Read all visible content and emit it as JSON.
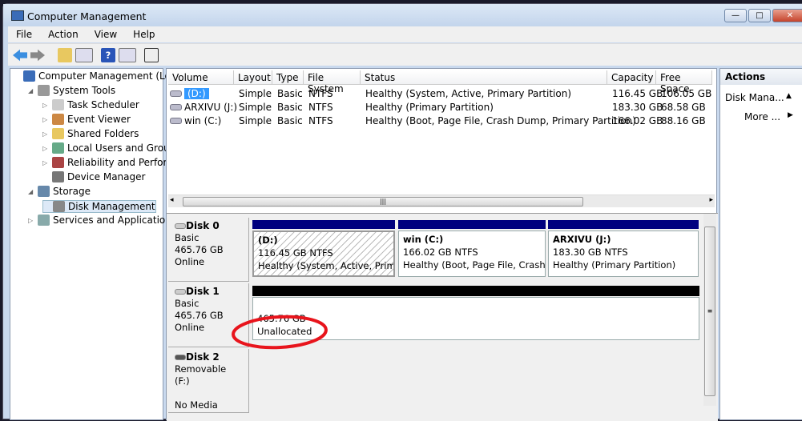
{
  "window": {
    "title": "Computer Management",
    "min": "—",
    "max": "□",
    "close": "✕"
  },
  "menu": [
    "File",
    "Action",
    "View",
    "Help"
  ],
  "toolbar": {
    "icons": [
      "back-arrow-icon",
      "forward-arrow-icon",
      "up-folder-icon",
      "show-hide-tree-icon",
      "help-icon",
      "show-action-pane-icon",
      "properties-icon"
    ]
  },
  "tree": [
    {
      "label": "Computer Management (Local",
      "level": 0,
      "exp": ""
    },
    {
      "label": "System Tools",
      "level": 1,
      "exp": "◢"
    },
    {
      "label": "Task Scheduler",
      "level": 2,
      "exp": "▷"
    },
    {
      "label": "Event Viewer",
      "level": 2,
      "exp": "▷"
    },
    {
      "label": "Shared Folders",
      "level": 2,
      "exp": "▷"
    },
    {
      "label": "Local Users and Groups",
      "level": 2,
      "exp": "▷"
    },
    {
      "label": "Reliability and Performa",
      "level": 2,
      "exp": "▷"
    },
    {
      "label": "Device Manager",
      "level": 2,
      "exp": ""
    },
    {
      "label": "Storage",
      "level": 1,
      "exp": "◢"
    },
    {
      "label": "Disk Management",
      "level": 2,
      "exp": ""
    },
    {
      "label": "Services and Applications",
      "level": 1,
      "exp": "▷"
    }
  ],
  "volumes": {
    "headers": [
      "Volume",
      "Layout",
      "Type",
      "File System",
      "Status",
      "Capacity",
      "Free Space"
    ],
    "rows": [
      [
        "(D:)",
        "Simple",
        "Basic",
        "NTFS",
        "Healthy (System, Active, Primary Partition)",
        "116.45 GB",
        "106.05 GB"
      ],
      [
        "ARXIVU (J:)",
        "Simple",
        "Basic",
        "NTFS",
        "Healthy (Primary Partition)",
        "183.30 GB",
        "68.58 GB"
      ],
      [
        "win (C:)",
        "Simple",
        "Basic",
        "NTFS",
        "Healthy (Boot, Page File, Crash Dump, Primary Partition)",
        "166.02 GB",
        "88.16 GB"
      ]
    ]
  },
  "disks": [
    {
      "name": "Disk 0",
      "type": "Basic",
      "size": "465.76 GB",
      "state": "Online",
      "parts": [
        {
          "name": "(D:)",
          "size": "116.45 GB NTFS",
          "status": "Healthy (System, Active, Primar"
        },
        {
          "name": "win  (C:)",
          "size": "166.02 GB NTFS",
          "status": "Healthy (Boot, Page File, Crash D"
        },
        {
          "name": "ARXIVU  (J:)",
          "size": "183.30 GB NTFS",
          "status": "Healthy (Primary Partition)"
        }
      ]
    },
    {
      "name": "Disk 1",
      "type": "Basic",
      "size": "465.76 GB",
      "state": "Online",
      "unalloc_size": "465.76 GB",
      "unalloc_label": "Unallocated"
    },
    {
      "name": "Disk 2",
      "type": "Removable (F:)",
      "state": "No Media"
    }
  ],
  "actions": {
    "header": "Actions",
    "items": [
      "Disk Mana...",
      "More ..."
    ]
  },
  "colors": {
    "primary_bar": "#00007f",
    "unalloc_bar": "#000000",
    "annotation": "#e8141c"
  }
}
